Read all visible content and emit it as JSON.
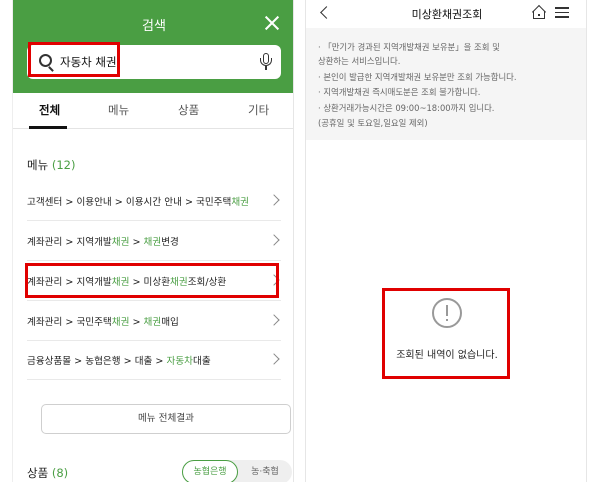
{
  "left": {
    "header_title": "검색",
    "search_value": "자동차 채권",
    "tabs": [
      "전체",
      "메뉴",
      "상품",
      "기타"
    ],
    "menu_section": {
      "label": "메뉴",
      "count": "(12)"
    },
    "menu_items": [
      {
        "parts": [
          {
            "t": "고객센터 > 이용안내 > 이용시간 안내 > 국민주택",
            "g": false
          },
          {
            "t": "채권",
            "g": true
          }
        ]
      },
      {
        "parts": [
          {
            "t": "계좌관리 > 지역개발",
            "g": false
          },
          {
            "t": "채권",
            "g": true
          },
          {
            "t": " > ",
            "g": false
          },
          {
            "t": "채권",
            "g": true
          },
          {
            "t": "변경",
            "g": false
          }
        ]
      },
      {
        "parts": [
          {
            "t": "계좌관리 > 지역개발",
            "g": false
          },
          {
            "t": "채권",
            "g": true
          },
          {
            "t": " > 미상환",
            "g": false
          },
          {
            "t": "채권",
            "g": true
          },
          {
            "t": "조회/상환",
            "g": false
          }
        ]
      },
      {
        "parts": [
          {
            "t": "계좌관리 > 국민주택",
            "g": false
          },
          {
            "t": "채권",
            "g": true
          },
          {
            "t": " > ",
            "g": false
          },
          {
            "t": "채권",
            "g": true
          },
          {
            "t": "매입",
            "g": false
          }
        ]
      },
      {
        "parts": [
          {
            "t": "금융상품몰 > 농협은행 > 대출 > ",
            "g": false
          },
          {
            "t": "자동차",
            "g": true
          },
          {
            "t": "대출",
            "g": false
          }
        ]
      }
    ],
    "all_results_label": "메뉴 전체결과",
    "product_section": {
      "label": "상품",
      "count": "(8)"
    },
    "toggle": {
      "on_label": "농협은행",
      "off_label": "농·축협"
    }
  },
  "right": {
    "title": "미상환채권조회",
    "notice_lines": [
      "· 「만기가 경과된 지역개발채권 보유분」을 조회 및",
      "  상환하는 서비스입니다.",
      "· 본인이 발급한 지역개발채권 보유분만 조회 가능합니다.",
      "· 지역개발채권 즉시매도분은 조회 불가합니다.",
      "· 상환거래가능시간은 09:00~18:00까지 입니다.",
      "  (공휴일 및 토요일,일요일 제외)"
    ],
    "empty_message": "조회된 내역이 없습니다."
  },
  "colors": {
    "brand_green": "#4a9e43",
    "highlight_red": "#e00000"
  }
}
